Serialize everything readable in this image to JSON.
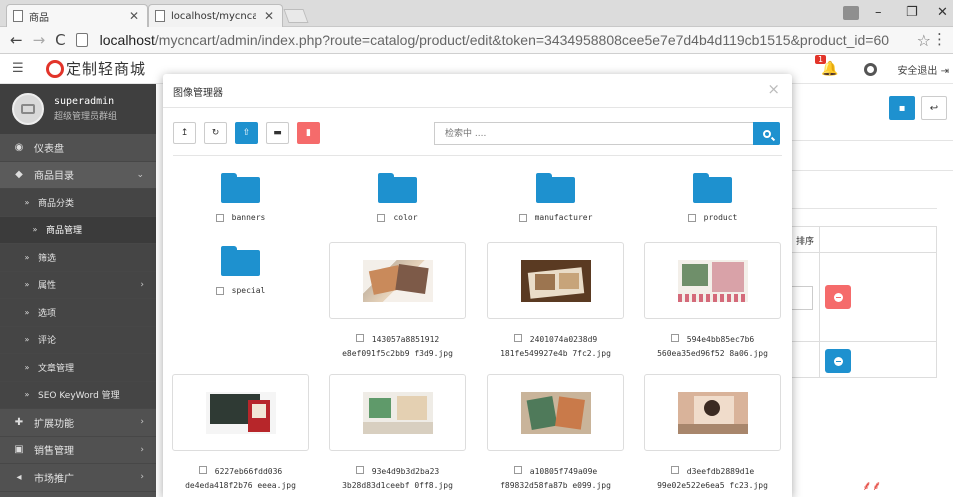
{
  "browser": {
    "tabs": [
      {
        "title": "商品"
      },
      {
        "title": "localhost/mycncart/inde"
      }
    ],
    "url_host": "localhost",
    "url_path": "/mycncart/admin/index.php?route=catalog/product/edit&token=3434958808cee5e7e7d4b4d119cb1515&product_id=60"
  },
  "header": {
    "logo_text": "定制轻商城",
    "notification_count": "1",
    "logout_label": "安全退出"
  },
  "sidebar": {
    "user_name": "superadmin",
    "user_role": "超级管理员群组",
    "items": [
      {
        "label": "仪表盘",
        "icon": "dashboard-icon",
        "glyph": "◉"
      },
      {
        "label": "商品目录",
        "icon": "tag-icon",
        "glyph": "◆"
      },
      {
        "label": "商品分类",
        "glyph": "»"
      },
      {
        "label": "商品管理",
        "glyph": "»"
      },
      {
        "label": "筛选",
        "glyph": "»"
      },
      {
        "label": "属性",
        "glyph": "»"
      },
      {
        "label": "选项",
        "glyph": "»"
      },
      {
        "label": "评论",
        "glyph": "»"
      },
      {
        "label": "文章管理",
        "glyph": "»"
      },
      {
        "label": "SEO KeyWord 管理",
        "glyph": "»"
      },
      {
        "label": "扩展功能",
        "icon": "puzzle-icon",
        "glyph": "✚"
      },
      {
        "label": "销售管理",
        "icon": "cart-icon",
        "glyph": "▣"
      },
      {
        "label": "市场推广",
        "icon": "share-icon",
        "glyph": "◂"
      }
    ]
  },
  "background": {
    "table_header": "排序"
  },
  "modal": {
    "title": "图像管理器",
    "search_placeholder": "检索中 ....",
    "folders": [
      {
        "name": "banners"
      },
      {
        "name": "color"
      },
      {
        "name": "manufacturer"
      },
      {
        "name": "product"
      },
      {
        "name": "special"
      }
    ],
    "images": [
      {
        "line1": "143057a8851912",
        "line2": "e8ef091f5c2bb9 f3d9.jpg"
      },
      {
        "line1": "2401074a0238d9",
        "line2": "181fe549927e4b 7fc2.jpg"
      },
      {
        "line1": "594e4bb85ec7b6",
        "line2": "560ea35ed96f52 8a06.jpg"
      },
      {
        "line1": "6227eb66fdd036",
        "line2": "de4eda418f2b76 eeea.jpg"
      },
      {
        "line1": "93e4d9b3d2ba23",
        "line2": "3b28d83d1ceebf 0ff8.jpg"
      },
      {
        "line1": "a10805f749a09e",
        "line2": "f89832d58fa87b e099.jpg"
      },
      {
        "line1": "d3eefdb2889d1e",
        "line2": "99e02e522e6ea5 fc23.jpg"
      }
    ]
  },
  "colors": {
    "primary": "#1e91cf",
    "danger": "#f56b6b",
    "sidebar": "#515151",
    "logo": "#e2342a"
  }
}
